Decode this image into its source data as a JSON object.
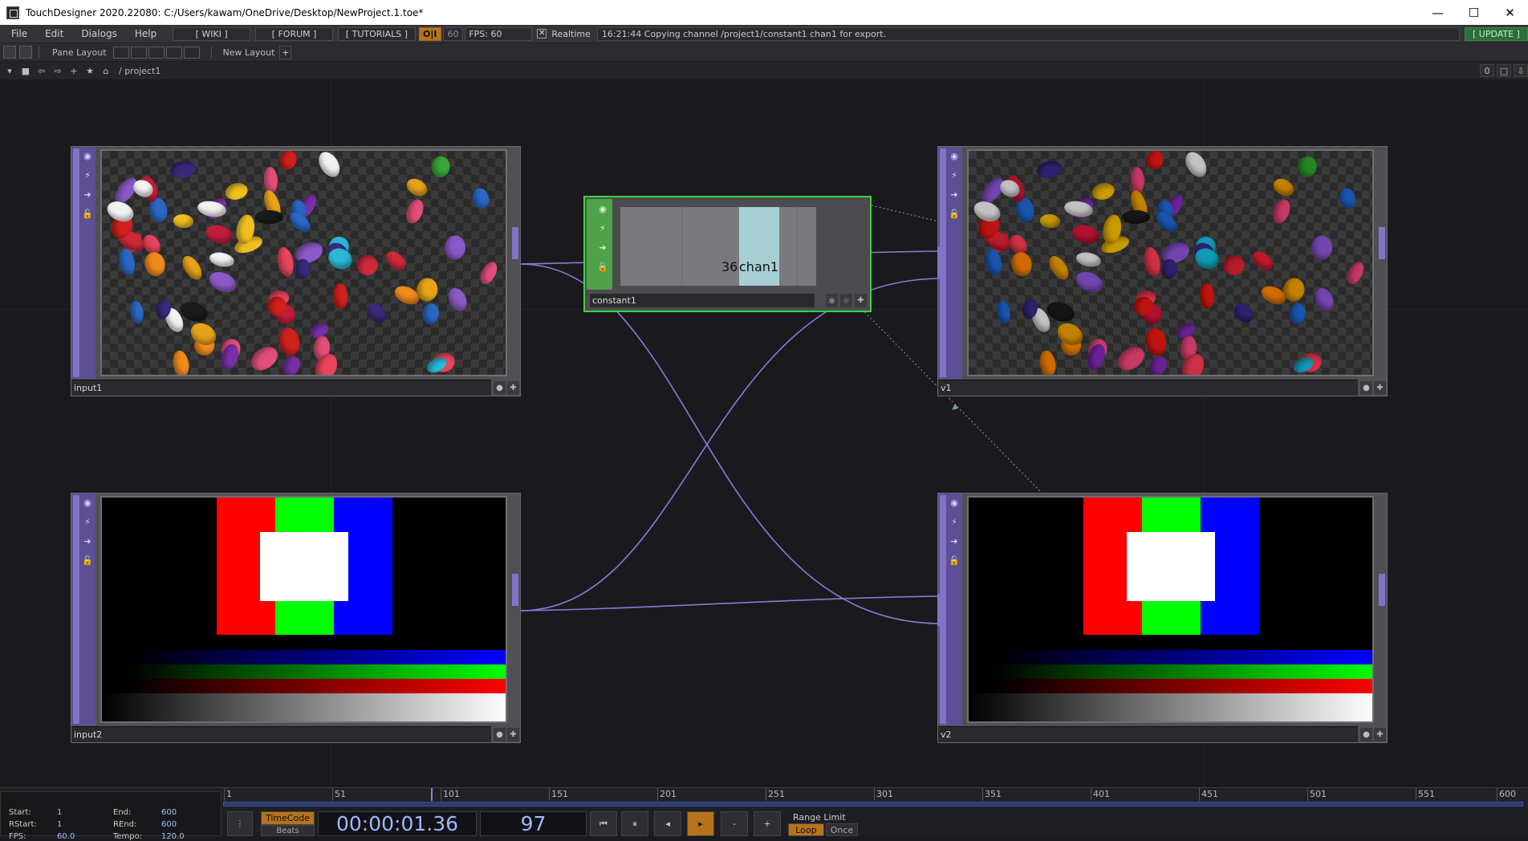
{
  "window": {
    "title": "TouchDesigner 2020.22080: C:/Users/kawam/OneDrive/Desktop/NewProject.1.toe*",
    "minimize": "—",
    "maximize": "☐",
    "close": "✕"
  },
  "menubar": {
    "items": [
      "File",
      "Edit",
      "Dialogs",
      "Help"
    ],
    "wiki": "[ WIKI ]",
    "forum": "[ FORUM ]",
    "tutorials": "[ TUTORIALS ]",
    "oii": "O|I",
    "fps_setting": "60",
    "fps_label": "FPS:  60",
    "realtime_label": "Realtime",
    "realtime_checked": "✕",
    "status": "16:21:44 Copying channel /project1/constant1 chan1 for export.",
    "update": "[ UPDATE ]"
  },
  "panebar": {
    "pane_layout": "Pane Layout",
    "new_layout": "New Layout",
    "add": "+"
  },
  "pathbar": {
    "path": "/  project1",
    "counter": "0"
  },
  "nodes": {
    "input1": {
      "name": "input1"
    },
    "input2": {
      "name": "input2"
    },
    "v1": {
      "name": "v1"
    },
    "v2": {
      "name": "v2"
    },
    "constant1": {
      "name": "constant1",
      "value": "36",
      "channel": "chan1"
    }
  },
  "timeline": {
    "ticks": [
      "1",
      "51",
      "101",
      "151",
      "201",
      "251",
      "301",
      "351",
      "401",
      "451",
      "501",
      "551",
      "600"
    ],
    "start_label": "Start:",
    "start": "1",
    "end_label": "End:",
    "end": "600",
    "rstart_label": "RStart:",
    "rstart": "1",
    "rend_label": "REnd:",
    "rend": "600",
    "fps_label": "FPS:",
    "fps": "60.0",
    "tempo_label": "Tempo:",
    "tempo": "120.0",
    "timecode_btn": "TimeCode",
    "beats_btn": "Beats",
    "timecode": "00:00:01.36",
    "frame": "97",
    "range_limit": "Range Limit",
    "loop": "Loop",
    "once": "Once",
    "current_frame_fraction": 0.16
  }
}
